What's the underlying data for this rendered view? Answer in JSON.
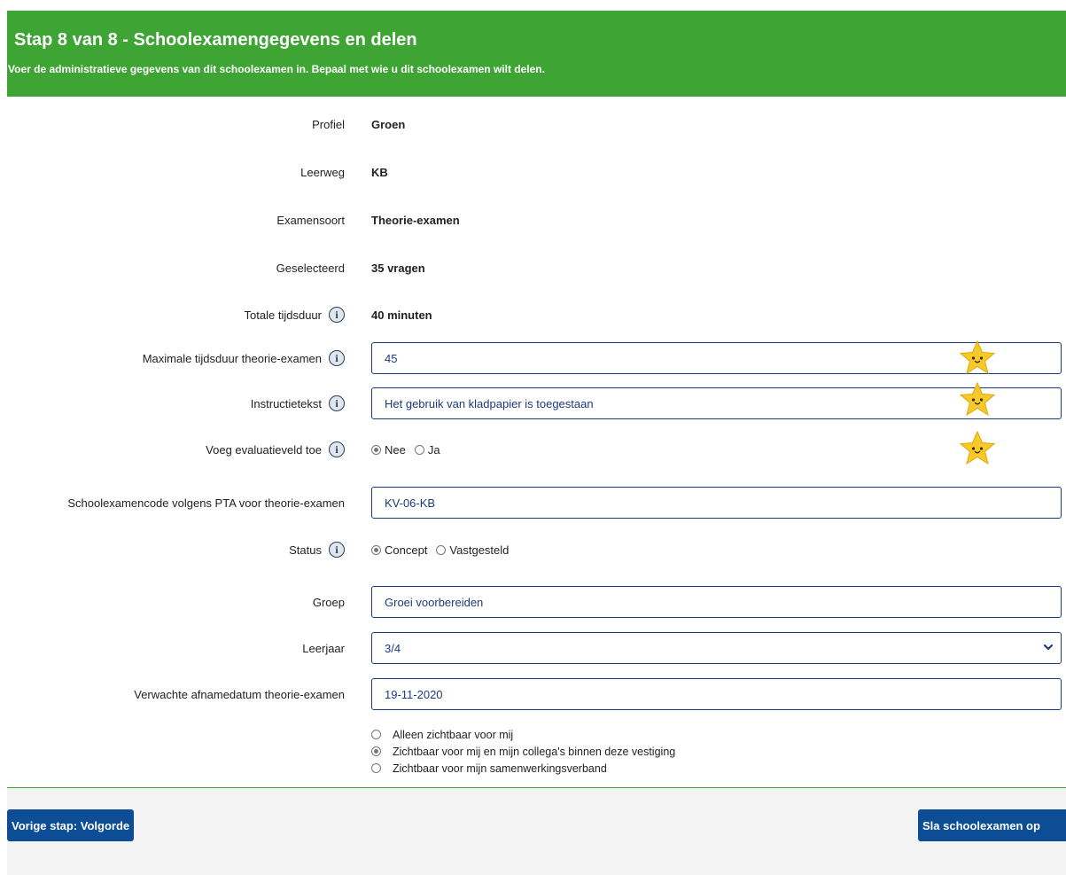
{
  "header": {
    "title": "Stap 8 van 8 - Schoolexamengegevens en delen",
    "subtitle": "Voer de administratieve gegevens van dit schoolexamen in. Bepaal met wie u dit schoolexamen wilt delen."
  },
  "form": {
    "profiel": {
      "label": "Profiel",
      "value": "Groen"
    },
    "leerweg": {
      "label": "Leerweg",
      "value": "KB"
    },
    "examensoort": {
      "label": "Examensoort",
      "value": "Theorie-examen"
    },
    "geselecteerd": {
      "label": "Geselecteerd",
      "value": "35 vragen"
    },
    "totale_tijdsduur": {
      "label": "Totale tijdsduur",
      "value": "40 minuten"
    },
    "maximale_tijdsduur": {
      "label": "Maximale tijdsduur theorie-examen",
      "value": "45"
    },
    "instructietekst": {
      "label": "Instructietekst",
      "value": "Het gebruik van kladpapier is toegestaan"
    },
    "evaluatieveld": {
      "label": "Voeg evaluatieveld toe",
      "options": [
        "Nee",
        "Ja"
      ],
      "selected": "Nee"
    },
    "schoolexamencode": {
      "label": "Schoolexamencode volgens PTA voor theorie-examen",
      "value": "KV-06-KB"
    },
    "status": {
      "label": "Status",
      "options": [
        "Concept",
        "Vastgesteld"
      ],
      "selected": "Concept"
    },
    "groep": {
      "label": "Groep",
      "value": "Groei voorbereiden"
    },
    "leerjaar": {
      "label": "Leerjaar",
      "value": "3/4"
    },
    "afnamedatum": {
      "label": "Verwachte afnamedatum theorie-examen",
      "value": "19-11-2020"
    }
  },
  "visibility": {
    "options": [
      "Alleen zichtbaar voor mij",
      "Zichtbaar voor mij en mijn collega's binnen deze vestiging",
      "Zichtbaar voor mijn samenwerkingsverband"
    ],
    "selected_index": 1
  },
  "footer": {
    "prev_button": "Vorige stap: Volgorde",
    "save_button": "Sla schoolexamen op"
  },
  "icons": {
    "info": "info-icon",
    "star": "star-icon",
    "select": "chevron-down-icon"
  },
  "colors": {
    "header_bg": "#3ea535",
    "button_bg": "#0d4d96",
    "field_border": "#1c3a7e",
    "star": "#f7c92a"
  }
}
